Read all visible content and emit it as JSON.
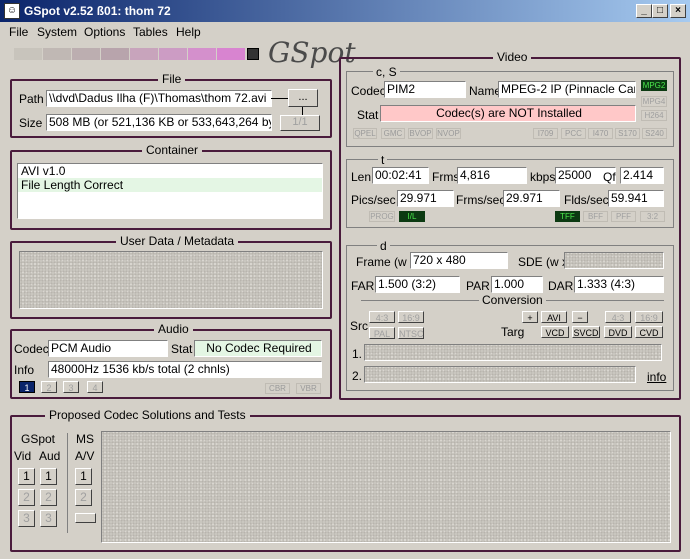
{
  "window": {
    "title": "GSpot v2.52 ß01: thom 72",
    "app_icon": "gspot-app-icon",
    "controls": [
      "_",
      "□",
      "×"
    ]
  },
  "menu": [
    "File",
    "System",
    "Options",
    "Tables",
    "Help"
  ],
  "logo": "GSpot",
  "palette_colors": [
    "#c8c4bc",
    "#c0b8b4",
    "#bcaeb0",
    "#b8a4ac",
    "#c8a4bc",
    "#cc9cc4",
    "#d490cc",
    "#d884d0"
  ],
  "file": {
    "title": "File",
    "path_label": "Path",
    "path_value": "\\\\dvd\\Dadus Ilha (F)\\Thomas\\thom 72.avi",
    "browse": "...",
    "size_label": "Size",
    "size_value": "508 MB (or 521,136 KB or 533,643,264 bytes)",
    "page": "1/1"
  },
  "container": {
    "title": "Container",
    "lines": [
      "AVI v1.0",
      "File Length Correct"
    ]
  },
  "userdata": {
    "title": "User Data / Metadata"
  },
  "audio": {
    "title": "Audio",
    "codec_label": "Codec",
    "codec_value": "PCM Audio",
    "stat_label": "Stat",
    "stat_value": "No Codec Required",
    "info_label": "Info",
    "info_value": "48000Hz  1536 kb/s total (2 chnls)",
    "streams": [
      "1",
      "2",
      "3",
      "4"
    ],
    "flags": [
      "CBR",
      "VBR"
    ]
  },
  "video": {
    "title": "Video",
    "cs_title": "c, S",
    "codec_label": "Codec",
    "codec_value": "PIM2",
    "name_label": "Name",
    "name_value": "MPEG-2 IP (Pinnacle Cards)",
    "stat_label": "Stat",
    "stat_value": "Codec(s) are NOT Installed",
    "mp_tags": [
      "MPG2",
      "MPG4",
      "H264"
    ],
    "flags_left": [
      "QPEL",
      "GMC",
      "BVOP",
      "NVOP"
    ],
    "flags_right": [
      "I709",
      "PCC",
      "I470",
      "S170",
      "S240"
    ],
    "t_title": "t",
    "len_label": "Len",
    "len_value": "00:02:41",
    "frms_label": "Frms",
    "frms_value": "4,816",
    "kbps_label": "kbps",
    "kbps_value": "25000",
    "qf_label": "Qf",
    "qf_value": "2.414",
    "pics_label": "Pics/sec",
    "pics_value": "29.971",
    "frmssec_label": "Frms/sec",
    "frmssec_value": "29.971",
    "flds_label": "Flds/sec",
    "flds_value": "59.941",
    "scan_tags": [
      "PROG",
      "I/L"
    ],
    "field_tags": [
      "TFF",
      "BFF",
      "PFF",
      "3:2"
    ],
    "d_title": "d",
    "frame_label": "Frame (w x",
    "frame_value": "720 x 480",
    "sde_label": "SDE (w x",
    "far_label": "FAR",
    "far_value": "1.500 (3:2)",
    "par_label": "PAR",
    "par_value": "1.000",
    "dar_label": "DAR",
    "dar_value": "1.333 (4:3)",
    "conversion_title": "Conversion",
    "src_label": "Src",
    "src_buttons": [
      "4:3",
      "16:9",
      "PAL",
      "NTSC"
    ],
    "targ_label": "Targ",
    "targ_buttons": [
      "+",
      "AVI",
      "−",
      "4:3",
      "16:9",
      "VCD",
      "SVCD",
      "DVD",
      "CVD"
    ],
    "row1": "1.",
    "row2": "2.",
    "info_link": "info"
  },
  "proposed": {
    "title": "Proposed Codec Solutions and Tests",
    "gspot_label": "GSpot",
    "vid_label": "Vid",
    "aud_label": "Aud",
    "ms_label": "MS",
    "av_label": "A/V",
    "nums": [
      "1",
      "2",
      "3"
    ]
  }
}
